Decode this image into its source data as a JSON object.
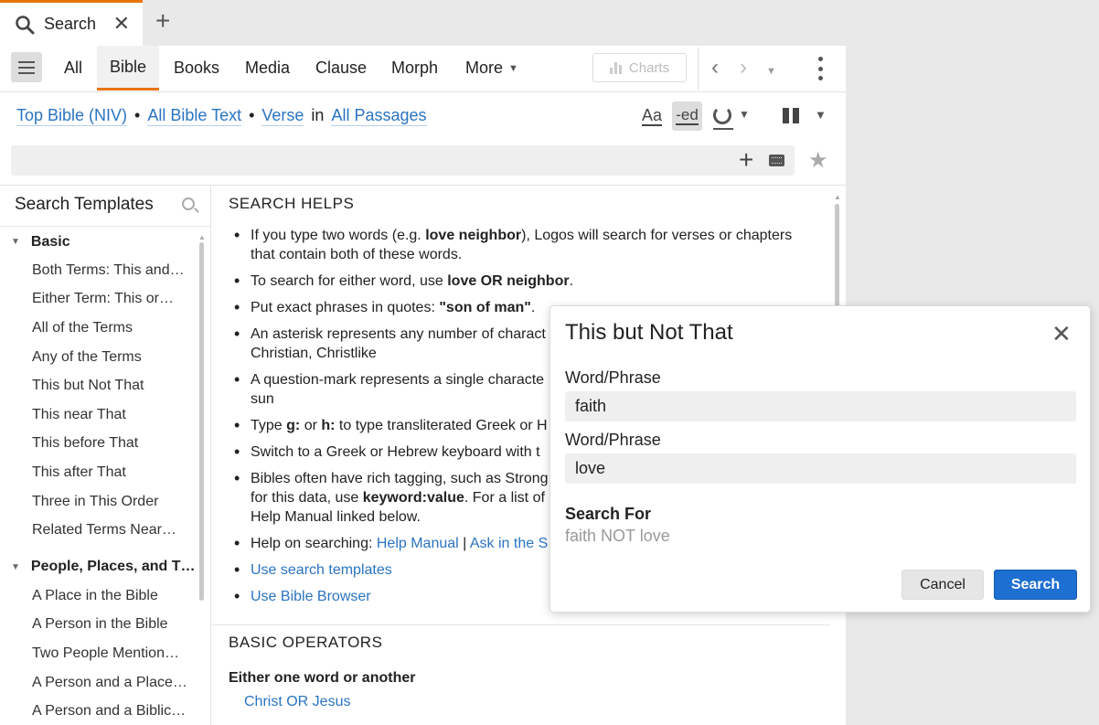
{
  "tab": {
    "title": "Search",
    "close_glyph": "✕",
    "new_tab_glyph": "+"
  },
  "nav": {
    "tabs": [
      {
        "label": "All"
      },
      {
        "label": "Bible"
      },
      {
        "label": "Books"
      },
      {
        "label": "Media"
      },
      {
        "label": "Clause"
      },
      {
        "label": "Morph"
      },
      {
        "label": "More"
      }
    ],
    "active": "Bible",
    "charts_label": "Charts",
    "back_glyph": "‹",
    "forward_glyph": "›"
  },
  "scope": {
    "bible": "Top Bible (NIV)",
    "text": "All Bible Text",
    "unit": "Verse",
    "in": "in",
    "passages": "All Passages",
    "separator": "•",
    "aa_label": "Aa",
    "ed_label": "-ed"
  },
  "search": {
    "value": "",
    "placeholder": ""
  },
  "sidebar": {
    "title": "Search Templates",
    "groups": [
      {
        "label": "Basic",
        "items": [
          "Both Terms: This and…",
          "Either Term: This or…",
          "All of the Terms",
          "Any of the Terms",
          "This but Not That",
          "This near That",
          "This before That",
          "This after That",
          "Three in This Order",
          "Related Terms Near…"
        ]
      },
      {
        "label": "People, Places, and T…",
        "items": [
          "A Place in the Bible",
          "A Person in the Bible",
          "Two People Mention…",
          "A Person and a Place…",
          "A Person and a Biblic…"
        ]
      }
    ]
  },
  "help": {
    "title": "SEARCH HELPS",
    "items": {
      "i1_a": "If you type two words (e.g. ",
      "i1_b": "love neighbor",
      "i1_c": "), Logos will search for verses or chapters that contain both of these words.",
      "i2_a": "To search for either word, use ",
      "i2_b": "love OR neighbor",
      "i2_c": ".",
      "i3_a": "Put exact phrases in quotes: ",
      "i3_b": "\"son of man\"",
      "i3_c": ".",
      "i4_a": "An asterisk represents any number of charact",
      "i4_b": "Christian, Christlike",
      "i5_a": "A question-mark represents a single characte",
      "i5_b": "sun",
      "i6_a": "Type ",
      "i6_b": "g:",
      "i6_c": " or ",
      "i6_d": "h:",
      "i6_e": " to type transliterated Greek or H",
      "i7_a": "Switch to a Greek or Hebrew keyboard with t",
      "i8_a": "Bibles often have rich tagging, such as Strong",
      "i8_b": "for this data, use ",
      "i8_c": "keyword:value",
      "i8_d": ". For a list of",
      "i8_e": "Help Manual linked below.",
      "i9_a": "Help on searching: ",
      "i9_b": "Help Manual",
      "i9_c": " | ",
      "i9_d": "Ask in the S",
      "i10": "Use search templates",
      "i11": "Use Bible Browser"
    },
    "ops_title": "BASIC OPERATORS",
    "ops_sub": "Either one word or another",
    "ops_example": "Christ OR Jesus"
  },
  "dialog": {
    "title": "This but Not That",
    "field1_label": "Word/Phrase",
    "field1_value": "faith",
    "field2_label": "Word/Phrase",
    "field2_value": "love",
    "search_for_label": "Search For",
    "search_for_value": "faith NOT love",
    "cancel_label": "Cancel",
    "search_label": "Search",
    "close_glyph": "✕"
  },
  "colors": {
    "accent": "#e8740c",
    "link": "#2a74c2",
    "primary_button": "#1d6fd1"
  }
}
